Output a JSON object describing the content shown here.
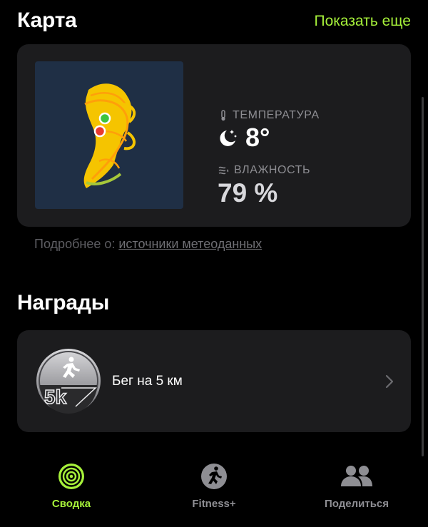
{
  "map_section": {
    "title": "Карта",
    "show_more": "Показать еще"
  },
  "weather": {
    "temperature_label": "ТЕМПЕРАТУРА",
    "temperature_value": "8°",
    "temperature_icon": "moon-stars-icon",
    "humidity_label": "ВЛАЖНОСТЬ",
    "humidity_value": "79 %",
    "humidity_icon": "humidity-icon"
  },
  "sources": {
    "prefix": "Подробнее о: ",
    "link": "источники метеоданных"
  },
  "awards_section": {
    "title": "Награды",
    "items": [
      {
        "label": "Бег на 5 км",
        "badge_icon": "5k-run-badge-icon"
      }
    ]
  },
  "tabbar": {
    "tabs": [
      {
        "label": "Сводка",
        "icon": "activity-rings-icon",
        "active": true
      },
      {
        "label": "Fitness+",
        "icon": "fitness-plus-icon",
        "active": false
      },
      {
        "label": "Поделиться",
        "icon": "sharing-icon",
        "active": false
      }
    ]
  },
  "colors": {
    "accent": "#a6f13a",
    "card_bg": "#1c1c1e",
    "route": "#f5c400",
    "start_marker": "#3ec43e",
    "end_marker": "#e8392f"
  }
}
